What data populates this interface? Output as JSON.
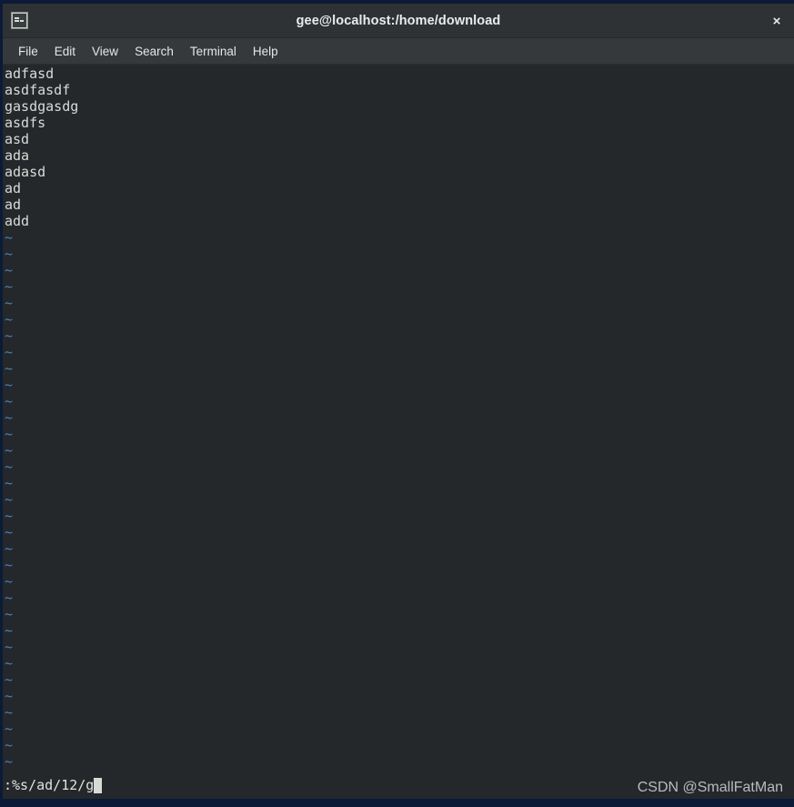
{
  "window": {
    "title": "gee@localhost:/home/download",
    "app_icon": "terminal-icon",
    "close_label": "×"
  },
  "menubar": {
    "items": [
      {
        "label": "File"
      },
      {
        "label": "Edit"
      },
      {
        "label": "View"
      },
      {
        "label": "Search"
      },
      {
        "label": "Terminal"
      },
      {
        "label": "Help"
      }
    ]
  },
  "terminal": {
    "editor": "vim",
    "buffer_lines": [
      "adfasd",
      "asdfasdf",
      "gasdgasdg",
      "asdfs",
      "asd",
      "ada",
      "adasd",
      "ad",
      "ad",
      "add"
    ],
    "empty_line_marker": "~",
    "empty_line_count": 34,
    "command_line": ":%s/ad/12/g",
    "cursor": "block"
  },
  "watermark": {
    "text": "CSDN @SmallFatMan"
  },
  "colors": {
    "desktop_border": "#0c1a38",
    "titlebar_bg": "#2e3234",
    "menubar_bg": "#35393b",
    "terminal_bg": "#24282b",
    "terminal_fg": "#d8dbd6",
    "tilde_fg": "#4f7eb5",
    "cursor": "#d8dbd6"
  }
}
